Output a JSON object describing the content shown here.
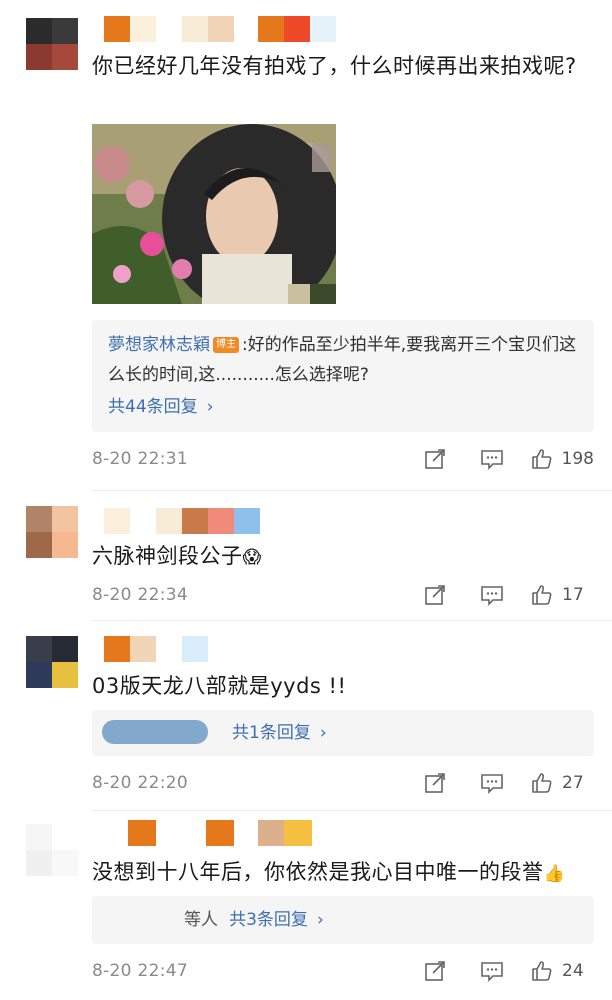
{
  "comments": [
    {
      "text": "你已经好几年没有拍戏了，什么时候再出来拍戏呢?",
      "reply": {
        "user": "夢想家林志穎",
        "badge": "博主",
        "text": ":好的作品至少拍半年,要我离开三个宝贝们这么长的时间,这...........怎么选择呢?",
        "count_label": "共44条回复",
        "arrow": "›"
      },
      "time": "8-20 22:31",
      "likes": "198"
    },
    {
      "text": "六脉神剑段公子",
      "emoji": "😱",
      "time": "8-20 22:34",
      "likes": "17"
    },
    {
      "text": "03版天龙八部就是yyds !!",
      "reply": {
        "count_label": "共1条回复",
        "arrow": "›"
      },
      "time": "8-20 22:20",
      "likes": "27"
    },
    {
      "text": "没想到十八年后，你依然是我心目中唯一的段誉",
      "emoji": "👍",
      "reply": {
        "prefix": "等人",
        "count_label": "共3条回复",
        "arrow": "›"
      },
      "time": "8-20 22:47",
      "likes": "24"
    }
  ],
  "icons": {
    "share": "share-icon",
    "comment": "comment-icon",
    "like": "thumbs-up-icon"
  },
  "colors": {
    "link": "#3d6fb0",
    "meta": "#8a8a8a",
    "badge": "#f08a24",
    "reply_bg": "#f5f5f5"
  }
}
